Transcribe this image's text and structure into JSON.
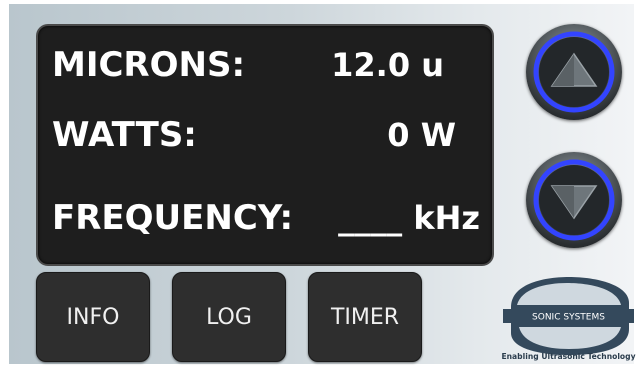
{
  "readout": {
    "microns_label": "MICRONS:",
    "microns_value": "12.0 u",
    "watts_label": "WATTS:",
    "watts_value": "0 W",
    "frequency_label": "FREQUENCY:",
    "frequency_value": "____ kHz"
  },
  "buttons": {
    "info": "INFO",
    "log": "LOG",
    "timer": "TIMER"
  },
  "controls": {
    "up_icon": "triangle-up-icon",
    "down_icon": "triangle-down-icon",
    "ring_color": "#3344ff"
  },
  "logo": {
    "brand": "SONIC SYSTEMS",
    "tagline": "Enabling Ultrasonic Technology"
  },
  "colors": {
    "display_bg": "#1e1e1e",
    "button_bg": "#2e2e2e",
    "text": "#ffffff"
  }
}
